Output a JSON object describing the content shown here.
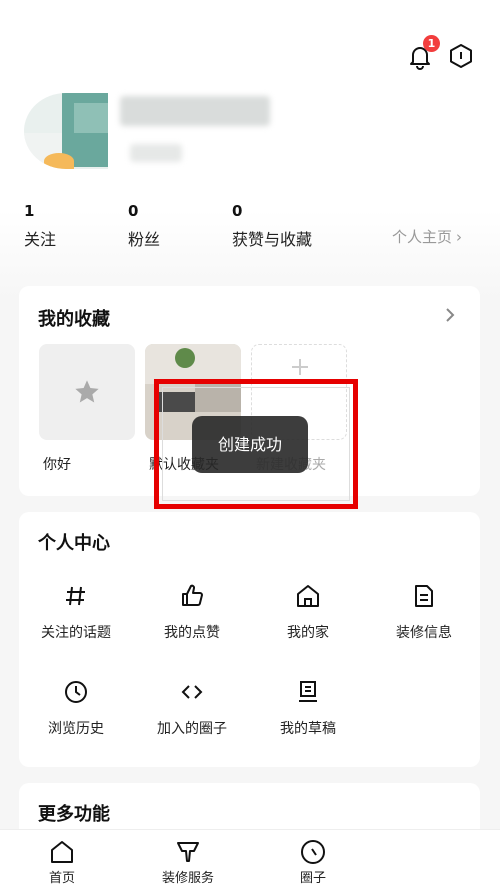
{
  "header": {
    "notification_count": "1",
    "bell_icon": "bell-icon",
    "settings_icon": "hexagon-info-icon"
  },
  "stats": [
    {
      "num": "1",
      "label": "关注"
    },
    {
      "num": "0",
      "label": "粉丝"
    },
    {
      "num": "0",
      "label": "获赞与收藏"
    }
  ],
  "homepage_link": "个人主页",
  "favorites": {
    "title": "我的收藏",
    "items": [
      {
        "label": "你好"
      },
      {
        "label": "默认收藏夹"
      },
      {
        "label": "新建收藏夹"
      }
    ]
  },
  "personal_center": {
    "title": "个人中心",
    "items": [
      {
        "label": "关注的话题",
        "icon": "hash-icon"
      },
      {
        "label": "我的点赞",
        "icon": "thumbs-up-icon"
      },
      {
        "label": "我的家",
        "icon": "home-icon"
      },
      {
        "label": "装修信息",
        "icon": "document-icon"
      },
      {
        "label": "浏览历史",
        "icon": "clock-icon"
      },
      {
        "label": "加入的圈子",
        "icon": "code-icon"
      },
      {
        "label": "我的草稿",
        "icon": "draft-icon"
      }
    ]
  },
  "more": {
    "title": "更多功能"
  },
  "toast": "创建成功",
  "tabbar": [
    {
      "label": "首页",
      "icon": "home-icon"
    },
    {
      "label": "装修服务",
      "icon": "service-icon"
    },
    {
      "label": "圈子",
      "icon": "compass-icon"
    }
  ],
  "colors": {
    "badge": "#f23d3d",
    "highlight": "#e60000",
    "background": "#f6f6f6"
  }
}
